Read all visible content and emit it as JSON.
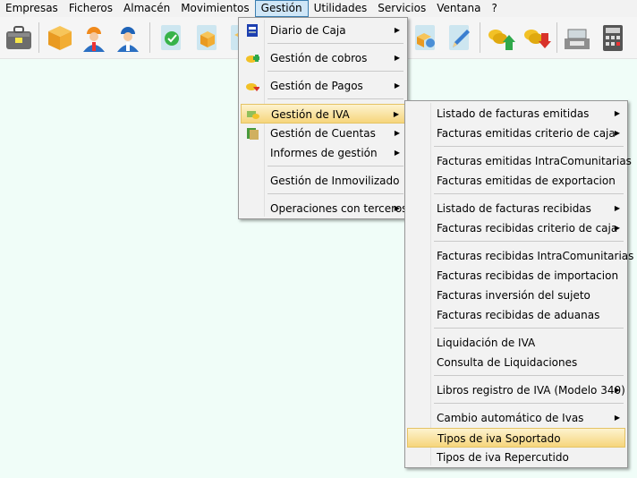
{
  "menubar": {
    "items": [
      "Empresas",
      "Ficheros",
      "Almacén",
      "Movimientos",
      "Gestión",
      "Utilidades",
      "Servicios",
      "Ventana",
      "?"
    ],
    "open_index": 4
  },
  "toolbar": {
    "icons": [
      "briefcase-icon",
      "box-icon",
      "worker-orange-icon",
      "worker-blue-icon",
      "document-check-icon",
      "package-icon",
      "package-icon",
      "document-settings-icon",
      "pen-icon",
      "coins-in-icon",
      "coins-out-icon",
      "cash-register-icon",
      "calculator-icon"
    ]
  },
  "gestion_menu": {
    "items": [
      {
        "label": "Diario de Caja",
        "icon": "book-icon",
        "submenu": true
      },
      {
        "label": "Gestión de cobros",
        "icon": "coins-plus-icon",
        "submenu": true
      },
      {
        "label": "Gestión de Pagos",
        "icon": "coins-minus-icon",
        "submenu": true
      },
      {
        "label": "Gestión de IVA",
        "icon": "money-icon",
        "submenu": true,
        "highlighted": true
      },
      {
        "label": "Gestión de Cuentas",
        "icon": "ledger-icon",
        "submenu": true
      },
      {
        "label": "Informes de gestión",
        "icon": "",
        "submenu": true
      },
      {
        "label": "Gestión de Inmovilizado",
        "icon": "",
        "submenu": false
      },
      {
        "label": "Operaciones con terceros",
        "icon": "",
        "submenu": true
      }
    ]
  },
  "iva_menu": {
    "items": [
      {
        "label": "Listado de facturas emitidas",
        "submenu": true
      },
      {
        "label": "Facturas emitidas criterio de caja",
        "submenu": true
      },
      {
        "label": "Facturas emitidas IntraComunitarias",
        "submenu": false
      },
      {
        "label": "Facturas emitidas de exportacion",
        "submenu": false
      },
      {
        "label": "Listado de facturas recibidas",
        "submenu": true
      },
      {
        "label": "Facturas recibidas criterio de caja",
        "submenu": true
      },
      {
        "label": "Facturas recibidas IntraComunitarias",
        "submenu": false
      },
      {
        "label": "Facturas recibidas de importacion",
        "submenu": false
      },
      {
        "label": "Facturas inversión del sujeto",
        "submenu": false
      },
      {
        "label": "Facturas recibidas de aduanas",
        "submenu": false
      },
      {
        "label": "Liquidación de IVA",
        "submenu": false
      },
      {
        "label": "Consulta de Liquidaciones",
        "submenu": false
      },
      {
        "label": "Libros registro de IVA (Modelo 340)",
        "submenu": true
      },
      {
        "label": "Cambio automático de Ivas",
        "submenu": true
      },
      {
        "label": "Tipos de iva Soportado",
        "submenu": false,
        "highlighted": true
      },
      {
        "label": "Tipos de iva Repercutido",
        "submenu": false
      }
    ]
  },
  "arrow_glyph": "▶"
}
